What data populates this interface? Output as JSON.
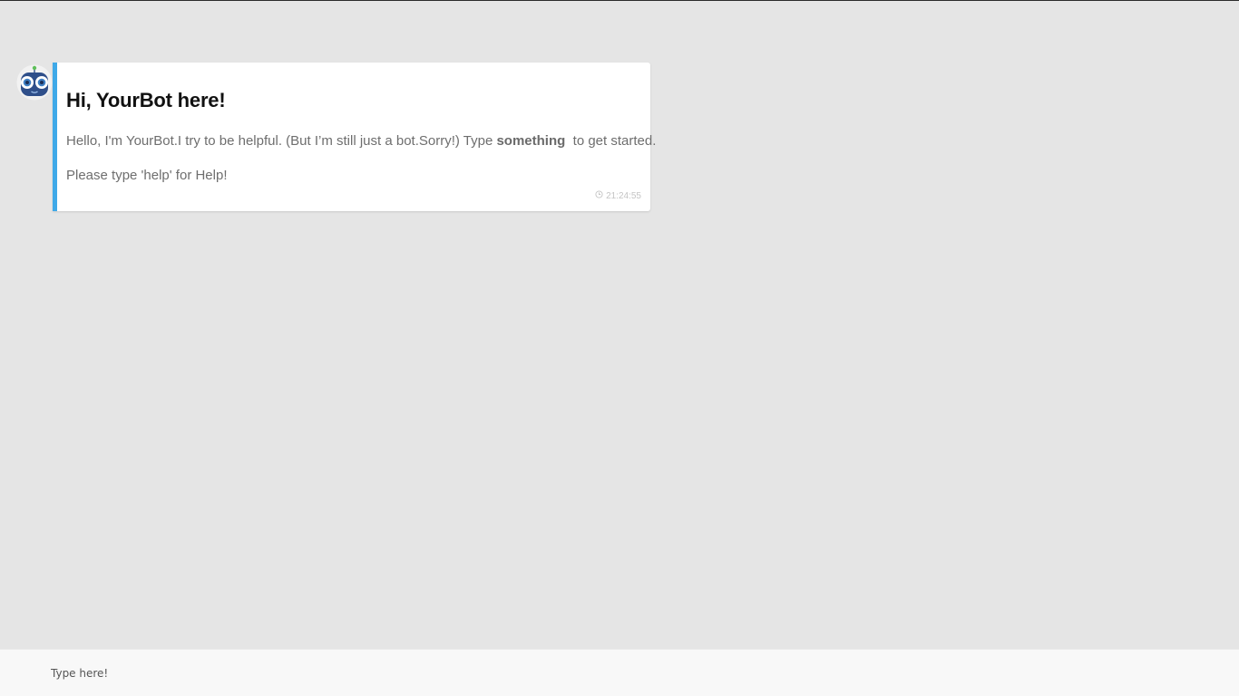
{
  "bot": {
    "avatar_icon": "robot-icon"
  },
  "message": {
    "title": "Hi, YourBot here!",
    "line1_prefix": "Hello, I'm YourBot.I try to be helpful. (But I’m still just a bot.Sorry!) Type ",
    "line1_bold": "something",
    "line1_suffix": "  to get started.",
    "line2": "Please type 'help' for Help!",
    "timestamp": "21:24:55"
  },
  "input": {
    "placeholder": "Type here!"
  },
  "colors": {
    "accent": "#3fa9e8",
    "background": "#e5e5e5",
    "bubble": "#ffffff",
    "input_bar": "#f8f8f8"
  }
}
